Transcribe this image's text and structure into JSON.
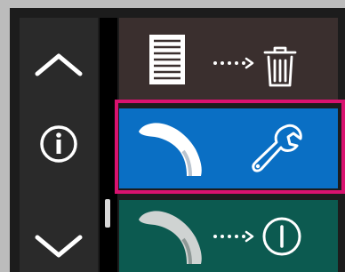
{
  "nav": {
    "up_icon": "chevron-up-icon",
    "info_icon": "info-icon",
    "down_icon": "chevron-down-icon"
  },
  "panels": [
    {
      "name": "delete-data",
      "icons": [
        "document-icon",
        "dotted-arrow-icon",
        "trash-icon"
      ],
      "background": "#3a2f2e"
    },
    {
      "name": "service-mode",
      "icons": [
        "handpiece-icon",
        "wrench-icon"
      ],
      "background": "#0a6fc4",
      "selected": true
    },
    {
      "name": "power-off",
      "icons": [
        "handpiece-icon",
        "dotted-arrow-icon",
        "power-icon"
      ],
      "background": "#0c5a50"
    }
  ],
  "colors": {
    "selection_border": "#d8126f",
    "icon": "#ffffff"
  }
}
